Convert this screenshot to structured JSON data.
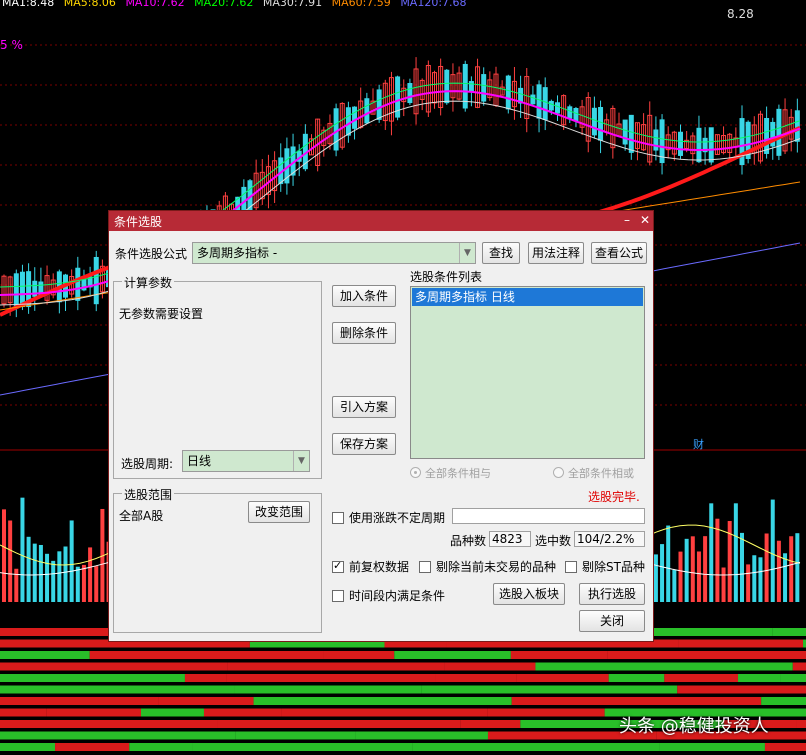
{
  "background_chart": {
    "legend": [
      "MA1:8.48",
      "MA5:8.06",
      "MA10:7.62",
      "MA20:7.62",
      "MA30:7.91",
      "MA60:7.59",
      "MA120:7.68"
    ],
    "percent_label": "5 %",
    "price_label": "8.28",
    "cai_label": "财"
  },
  "dialog": {
    "title": "条件选股",
    "formula_label": "条件选股公式",
    "formula_value": "多周期多指标 -",
    "search_btn": "查找",
    "usage_btn": "用法注释",
    "view_formula_btn": "查看公式",
    "params_group": "计算参数",
    "params_text": "无参数需要设置",
    "period_label": "选股周期:",
    "period_value": "日线",
    "range_group": "选股范围",
    "range_value": "全部A股",
    "change_range_btn": "改变范围",
    "add_cond_btn": "加入条件",
    "delete_cond_btn": "删除条件",
    "import_plan_btn": "引入方案",
    "save_plan_btn": "保存方案",
    "cond_list_title": "选股条件列表",
    "cond_list": [
      "多周期多指标  日线"
    ],
    "radio_and": "全部条件相与",
    "radio_or": "全部条件相或",
    "status": "选股完毕.",
    "use_uncertain_period": "使用涨跌不定周期",
    "stock_count_label": "品种数",
    "stock_count": "4823",
    "selected_label": "选中数",
    "selected_value": "104/2.2%",
    "pre_adjust": "前复权数据",
    "exclude_untraded": "剔除当前未交易的品种",
    "exclude_st": "剔除ST品种",
    "time_range_cond": "时间段内满足条件",
    "to_block_btn": "选股入板块",
    "execute_btn": "执行选股",
    "close_btn": "关闭"
  },
  "watermark": "头条 @稳健投资人",
  "colors": {
    "up": "#ff4040",
    "down": "#39d6e6",
    "ma_red": "#ff1a1a",
    "ma_orange": "#ff8c00",
    "ma_blue": "#6a6aff",
    "titlebar": "#b72a36",
    "list_bg": "#cfe8cf",
    "selection": "#1e78d7"
  }
}
